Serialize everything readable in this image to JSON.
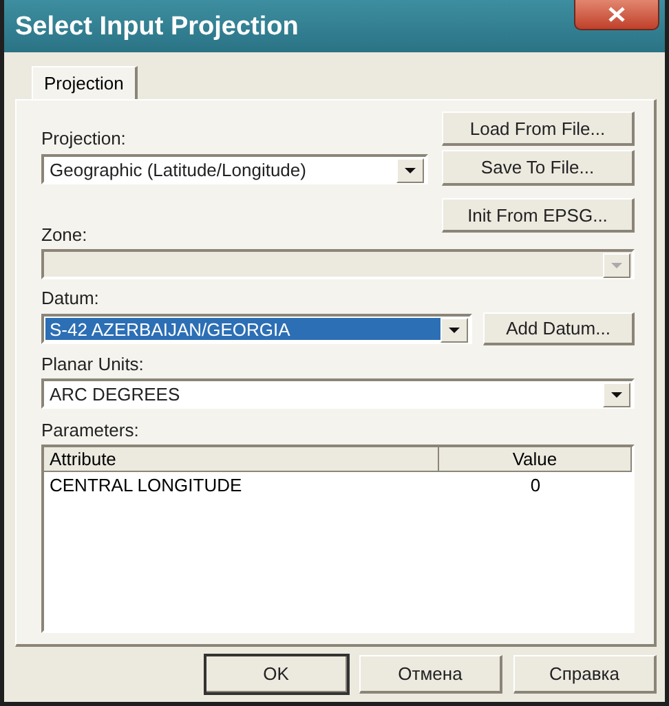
{
  "window": {
    "title": "Select Input Projection"
  },
  "tabs": [
    {
      "label": "Projection",
      "selected": true
    }
  ],
  "projection": {
    "label": "Projection:",
    "value": "Geographic (Latitude/Longitude)",
    "disabled": false,
    "highlighted": false
  },
  "side_buttons": [
    "Load From File...",
    "Save To File...",
    "Init From EPSG..."
  ],
  "zone": {
    "label": "Zone:",
    "disabled": true,
    "highlighted": false
  },
  "datum": {
    "label": "Datum:",
    "value": "S-42 AZERBAIJAN/GEORGIA",
    "disabled": false,
    "highlighted": true,
    "button": "Add Datum..."
  },
  "planar_units": {
    "label": "Planar Units:",
    "value": "ARC DEGREES",
    "disabled": false,
    "highlighted": false
  },
  "parameters": {
    "label": "Parameters:",
    "columns": [
      "Attribute",
      "Value"
    ],
    "rows": [
      {
        "attribute": "CENTRAL LONGITUDE",
        "value": "0"
      }
    ]
  },
  "buttons": [
    {
      "label": "OK",
      "default": true
    },
    {
      "label": "Отмена",
      "default": false
    },
    {
      "label": "Справка",
      "default": false
    }
  ]
}
